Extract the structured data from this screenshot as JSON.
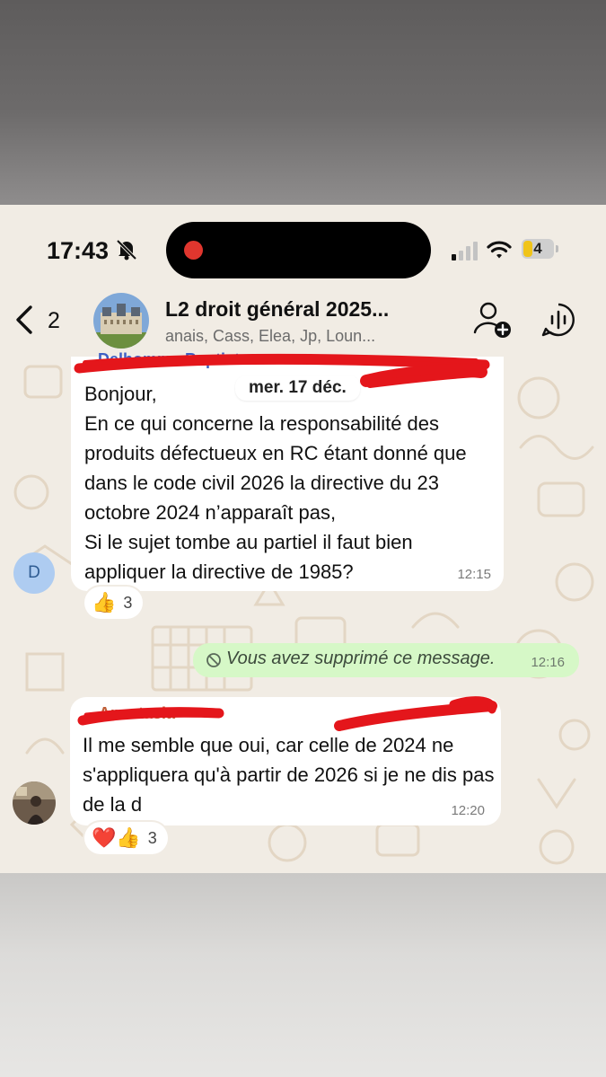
{
  "status_bar": {
    "time": "17:43",
    "battery": "4"
  },
  "header": {
    "back_count": "2",
    "title": "L2 droit général 2025...",
    "members": "anais, Cass, Elea, Jp, Loun..."
  },
  "icons": {
    "back": "chevron-left-icon",
    "add_member": "add-person-icon",
    "voice_chat": "audio-wave-icon",
    "silent": "bell-slash-icon"
  },
  "chat": {
    "date_separator": "mer. 17 déc.",
    "messages": [
      {
        "sender": "Delhomme Baptiste",
        "avatar_letter": "D",
        "text": "Bonjour,\nEn ce qui concerne la responsabilité des produits défectueux en RC étant donné que dans le code civil 2026 la directive du 23 octobre 2024 n’apparaît pas,\nSi le sujet tombe au partiel il faut bien appliquer la directive de 1985?",
        "time": "12:15",
        "reactions": {
          "emoji": "👍",
          "count": "3"
        }
      },
      {
        "outgoing_deleted": true,
        "text": "Vous avez supprimé ce message.",
        "time": "12:16"
      },
      {
        "sender": "Anastasia",
        "text": "Il me semble que oui, car celle de 2024 ne s'appliquera qu'à partir de 2026 si je ne dis pas de la d",
        "time": "12:20",
        "reactions": {
          "emoji": "❤️👍",
          "count": "3"
        }
      }
    ]
  },
  "colors": {
    "chat_background": "#f1ece4",
    "outgoing_bubble": "#d6f8c7",
    "redaction_marker": "#e4161b",
    "avatar_d_bg": "#aeccf1"
  }
}
